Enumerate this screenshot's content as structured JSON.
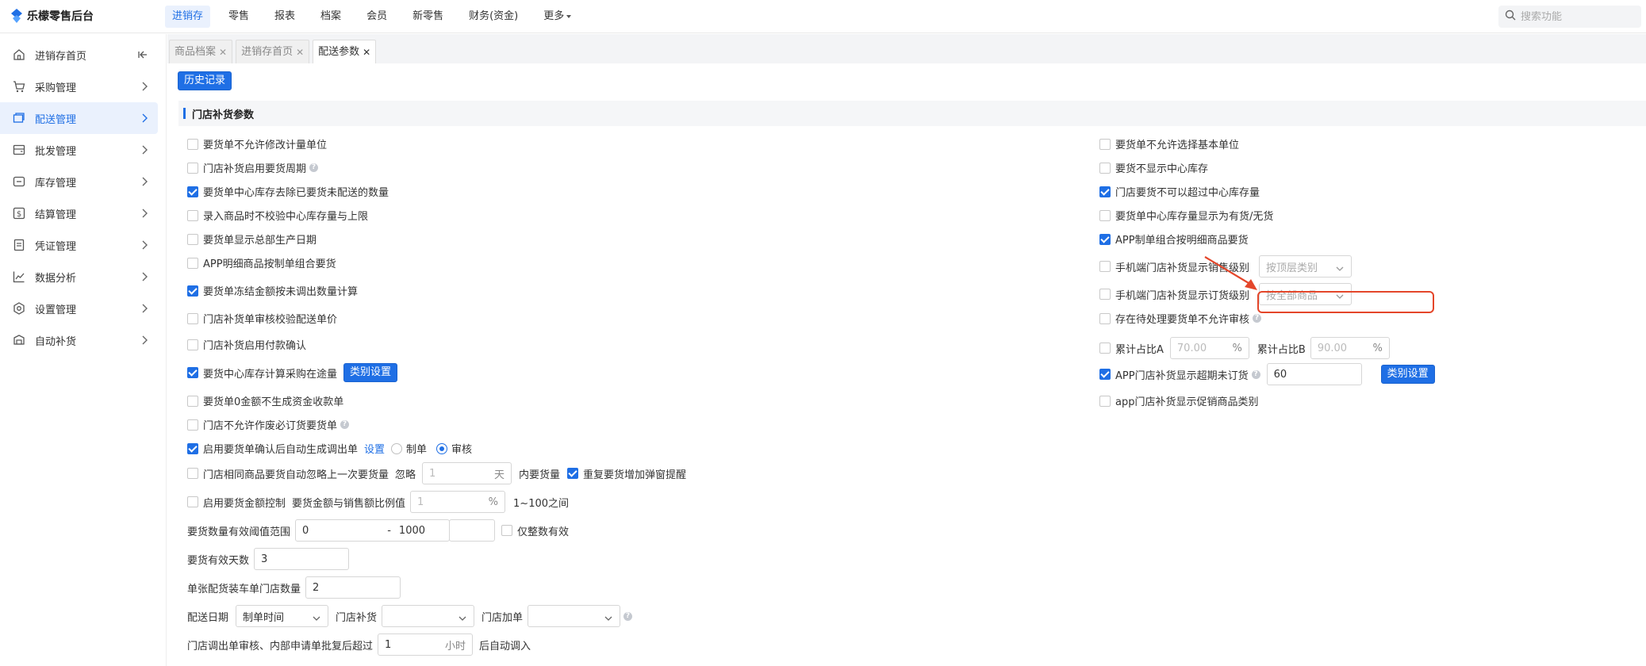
{
  "app": {
    "title": "乐檬零售后台"
  },
  "topnav": [
    {
      "label": "进销存",
      "active": true
    },
    {
      "label": "零售"
    },
    {
      "label": "报表"
    },
    {
      "label": "档案"
    },
    {
      "label": "会员"
    },
    {
      "label": "新零售"
    },
    {
      "label": "财务(资金)"
    },
    {
      "label": "更多"
    }
  ],
  "search": {
    "placeholder": "搜索功能"
  },
  "sidebar": [
    {
      "label": "进销存首页",
      "icon": "home-icon"
    },
    {
      "label": "采购管理",
      "icon": "cart-icon"
    },
    {
      "label": "配送管理",
      "icon": "delivery-icon",
      "active": true
    },
    {
      "label": "批发管理",
      "icon": "wholesale-icon"
    },
    {
      "label": "库存管理",
      "icon": "inventory-icon"
    },
    {
      "label": "结算管理",
      "icon": "settlement-icon"
    },
    {
      "label": "凭证管理",
      "icon": "voucher-icon"
    },
    {
      "label": "数据分析",
      "icon": "chart-icon"
    },
    {
      "label": "设置管理",
      "icon": "settings-icon"
    },
    {
      "label": "自动补货",
      "icon": "auto-replenish-icon"
    }
  ],
  "tabs": [
    {
      "label": "商品档案"
    },
    {
      "label": "进销存首页"
    },
    {
      "label": "配送参数",
      "active": true
    }
  ],
  "toolbar": {
    "history_label": "历史记录"
  },
  "section": {
    "title": "门店补货参数"
  },
  "left": {
    "r1": "要货单不允许修改计量单位",
    "r2": "门店补货启用要货周期",
    "r3": "要货单中心库存去除已要货未配送的数量",
    "r4": "录入商品时不校验中心库存量与上限",
    "r5": "要货单显示总部生产日期",
    "r6": "APP明细商品按制单组合要货",
    "r7": "要货单冻结金额按未调出数量计算",
    "r8": "门店补货单审核校验配送单价",
    "r9": "门店补货启用付款确认",
    "r10": "要货中心库存计算采购在途量",
    "r10_btn": "类别设置",
    "r11": "要货单0金额不生成资金收款单",
    "r12": "门店不允许作废必订货要货单",
    "r13": "启用要货单确认后自动生成调出单",
    "r13_link": "设置",
    "r13_opt1": "制单",
    "r13_opt2": "审核",
    "r14": "门店相同商品要货自动忽略上一次要货量",
    "r14_ignore": "忽略",
    "r14_value": "1",
    "r14_unit": "天",
    "r14_after": "内要货量",
    "r14_check2": "重复要货增加弹窗提醒",
    "r15": "启用要货金额控制",
    "r15_mid": "要货金额与销售额比例值",
    "r15_value": "1",
    "r15_unit": "%",
    "r15_after": "1~100之间",
    "r16": "要货数量有效阈值范围",
    "r16_min": "0",
    "r16_dash": "-",
    "r16_max": "1000",
    "r16_check": "仅整数有效",
    "r17": "要货有效天数",
    "r17_value": "3",
    "r18": "单张配货装车单门店数量",
    "r18_value": "2",
    "r19": "配送日期",
    "r19_sel": "制单时间",
    "r19_mid": "门店补货",
    "r19_mid2": "门店加单",
    "r20": "门店调出单审核、内部申请单批复后超过",
    "r20_value": "1",
    "r20_unit": "小时",
    "r20_after": "后自动调入"
  },
  "right": {
    "r1": "要货单不允许选择基本单位",
    "r2": "要货不显示中心库存",
    "r3": "门店要货不可以超过中心库存量",
    "r4": "要货单中心库存量显示为有货/无货",
    "r5": "APP制单组合按明细商品要货",
    "r6": "手机端门店补货显示销售级别",
    "r6_sel": "按顶层类别",
    "r7": "手机端门店补货显示订货级别",
    "r7_sel": "按全部商品",
    "r8": "存在待处理要货单不允许审核",
    "r9": "累计占比A",
    "r9_a": "70.00",
    "r9_unit": "%",
    "r9_b_label": "累计占比B",
    "r9_b": "90.00",
    "r10": "APP门店补货显示超期未订货",
    "r10_value": "60",
    "r10_btn": "类别设置",
    "r11": "app门店补货显示促销商品类别"
  },
  "colors": {
    "accent": "#1f6fe5",
    "annotation": "#e4462a"
  }
}
